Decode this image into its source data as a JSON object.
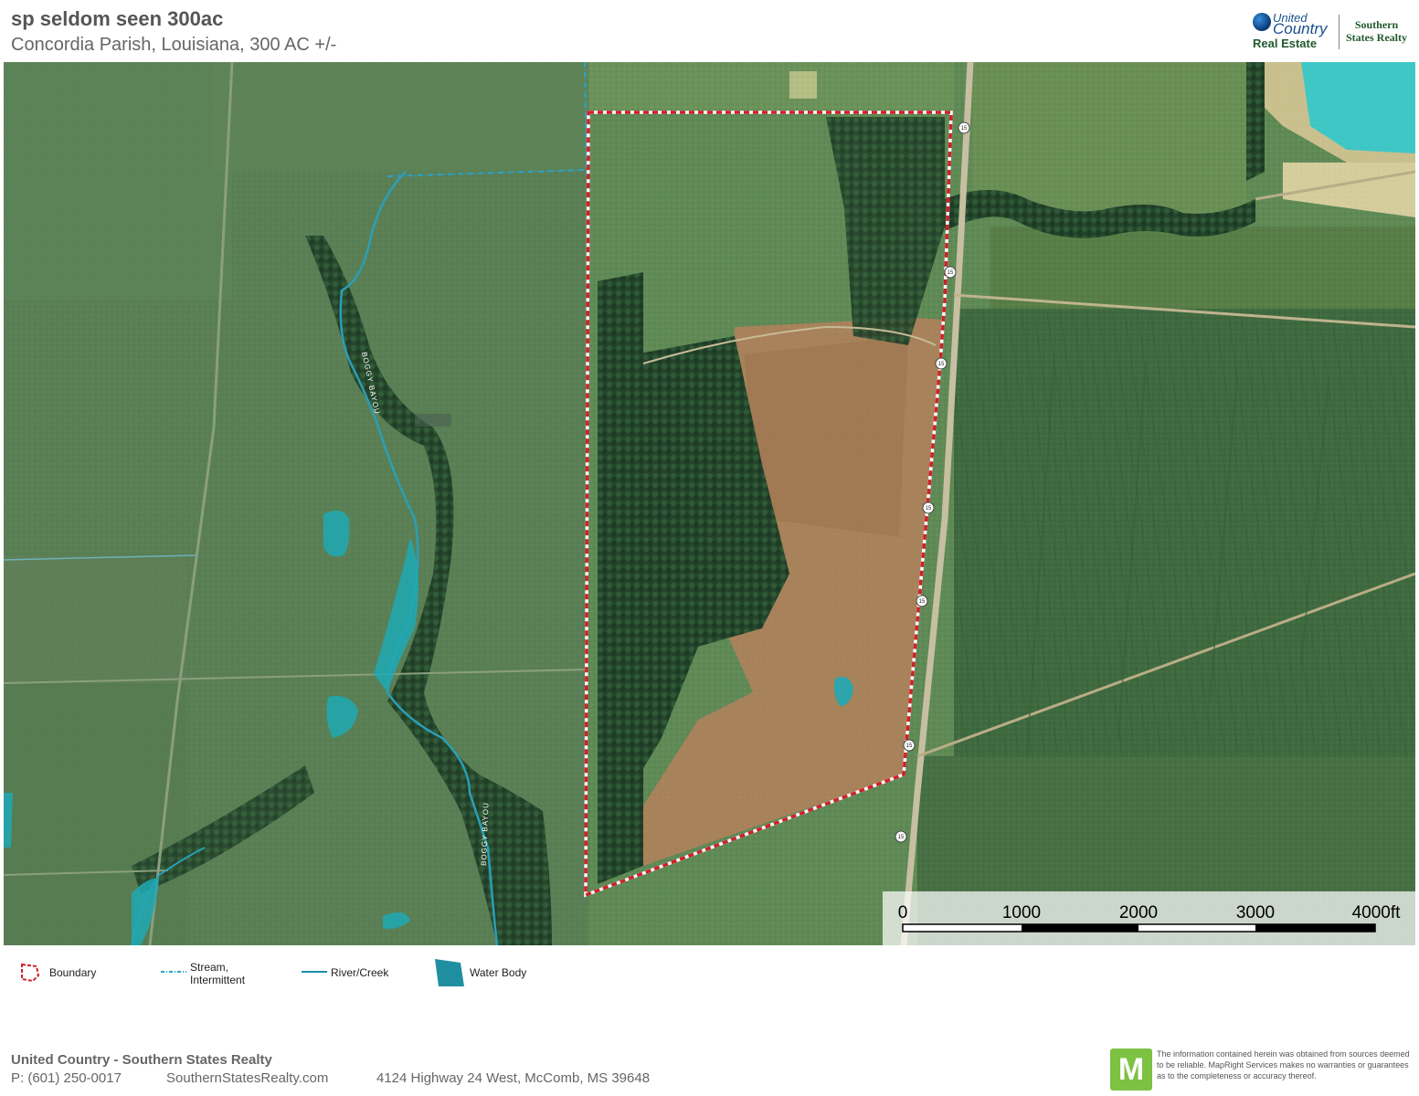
{
  "header": {
    "title": "sp seldom seen 300ac",
    "subtitle": "Concordia Parish, Louisiana, 300 AC +/-"
  },
  "logo": {
    "united": "United",
    "country": "Country",
    "real_estate": "Real Estate",
    "southern": "Southern",
    "states_realty": "States Realty"
  },
  "map": {
    "road_shield": "15",
    "creek_labels": [
      "BOGGY BAYOU",
      "BOGGY BAYOU"
    ],
    "scale_bar": {
      "labels": [
        "0",
        "1000",
        "2000",
        "3000",
        "4000ft"
      ]
    }
  },
  "legend": {
    "items": [
      {
        "label": "Boundary",
        "icon": "boundary-icon"
      },
      {
        "label": "Stream,",
        "label2": "Intermittent",
        "icon": "stream-intermittent-icon"
      },
      {
        "label": "River/Creek",
        "icon": "river-creek-icon"
      },
      {
        "label": "Water Body",
        "icon": "water-body-icon"
      }
    ]
  },
  "footer": {
    "company": "United Country - Southern States Realty",
    "phone": "P: (601) 250-0017",
    "website": "SouthernStatesRealty.com",
    "address": "4124 Highway 24 West, McComb, MS 39648",
    "mapright_letter": "M",
    "disclaimer": "The information contained herein was obtained from sources deemed to be reliable. MapRight Services makes no warranties or guarantees as to the completeness or accuracy thereof."
  },
  "colors": {
    "boundary": "#d0202a",
    "water": "#1fa9b5",
    "stream": "#2aa3c9"
  }
}
